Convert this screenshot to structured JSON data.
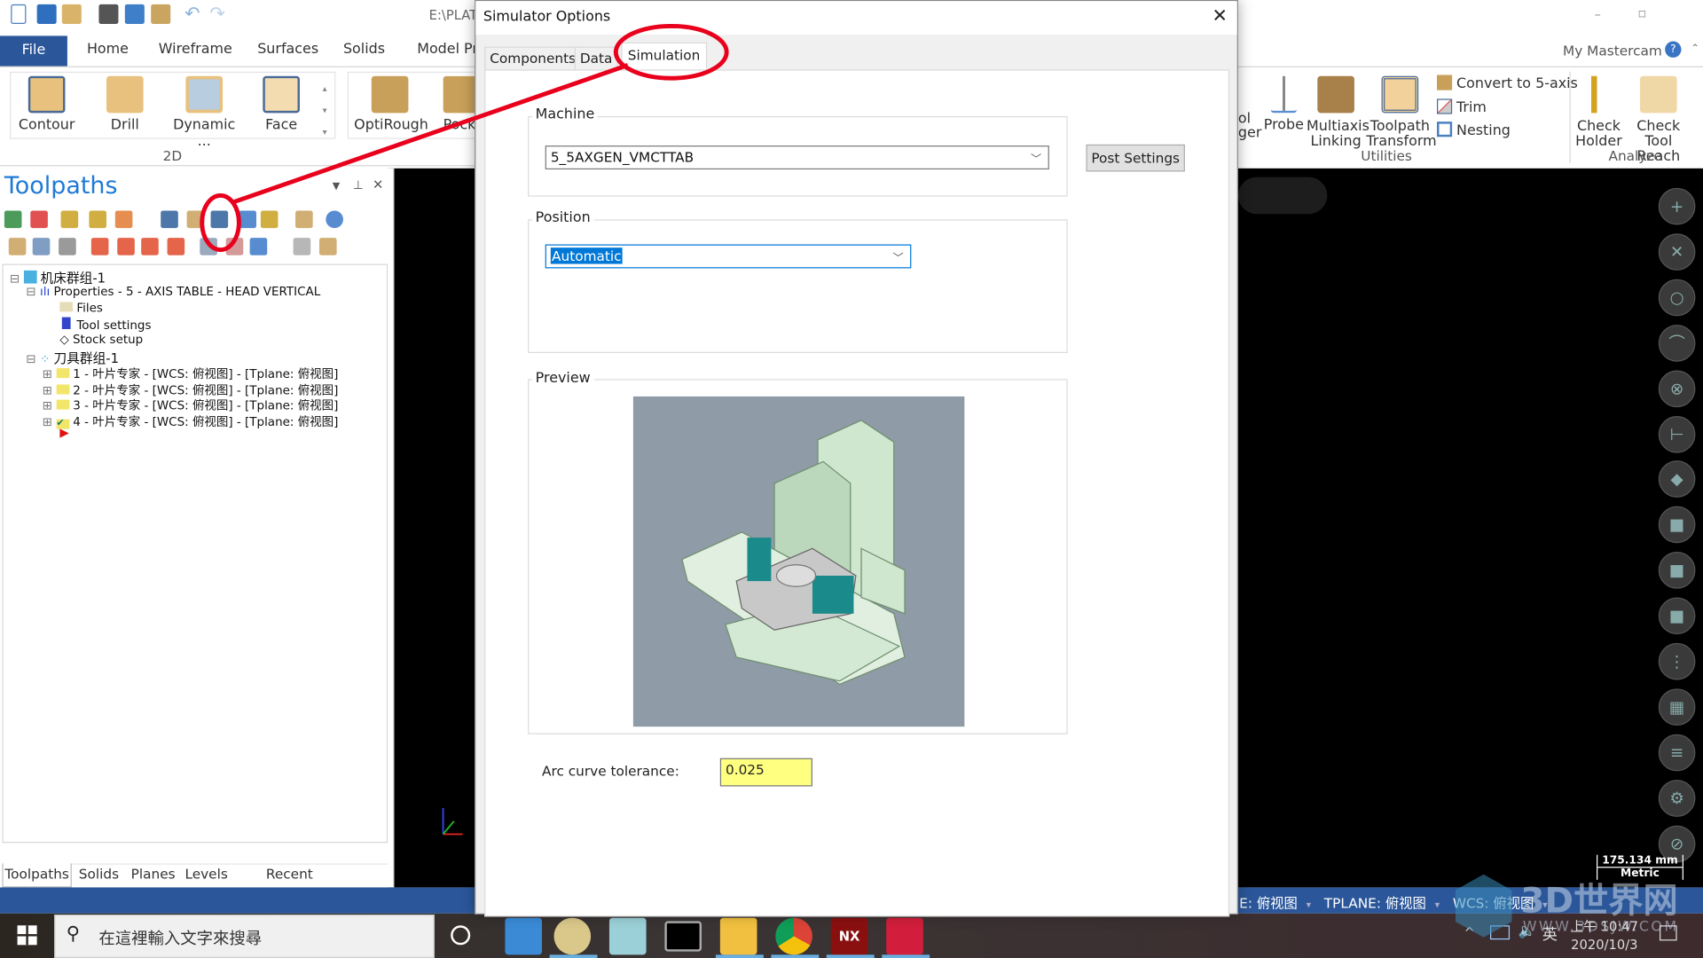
{
  "app": {
    "title_fragment": "E:\\PLAT",
    "my_mastercam": "My Mastercam"
  },
  "ribbon": {
    "tabs": [
      "File",
      "Home",
      "Wireframe",
      "Surfaces",
      "Solids",
      "Model Pr"
    ],
    "left_buttons": [
      "Contour",
      "Drill",
      "Dynamic ...",
      "Face",
      "OptiRough",
      "Pock"
    ],
    "left_group": "2D",
    "right_partial": [
      "ol",
      "ger"
    ],
    "probe": "Probe",
    "multiaxis": [
      "Multiaxis",
      "Linking"
    ],
    "transform": [
      "Toolpath",
      "Transform"
    ],
    "small": [
      "Convert to 5-axis",
      "Trim",
      "Nesting"
    ],
    "utilities_group": "Utilities",
    "check_holder": [
      "Check",
      "Holder"
    ],
    "check_reach": [
      "Check",
      "Tool Reach"
    ],
    "analyze_group": "Analyze"
  },
  "toolpaths": {
    "title": "Toolpaths",
    "tree": {
      "machine_group": "机床群组-1",
      "properties": "Properties - 5 - AXIS TABLE - HEAD VERTICAL",
      "files": "Files",
      "tool_settings": "Tool settings",
      "stock_setup": "Stock setup",
      "toolpath_group": "刀具群组-1",
      "ops": [
        "1 - 叶片专家 - [WCS: 俯视图] - [Tplane: 俯视图]",
        "2 - 叶片专家 - [WCS: 俯视图] - [Tplane: 俯视图]",
        "3 - 叶片专家 - [WCS: 俯视图] - [Tplane: 俯视图]",
        "4 - 叶片专家 - [WCS: 俯视图] - [Tplane: 俯视图]"
      ]
    },
    "bottom_tabs": [
      "Toolpaths",
      "Solids",
      "Planes",
      "Levels",
      "Recent Functions"
    ]
  },
  "dialog": {
    "title": "Simulator Options",
    "tabs": [
      "Components",
      "Data",
      "Simulation"
    ],
    "active_tab": "Simulation",
    "machine_label": "Machine",
    "machine_value": "5_5AXGEN_VMCTTAB",
    "post_settings": "Post Settings",
    "position_label": "Position",
    "position_value": "Automatic",
    "preview_label": "Preview",
    "arc_label": "Arc curve tolerance:",
    "arc_value": "0.025"
  },
  "status": {
    "items": [
      "E: 俯视图",
      "TPLANE: 俯视图",
      "WCS: 俯视图"
    ]
  },
  "scale": {
    "value": "175.134 mm",
    "unit": "Metric"
  },
  "taskbar": {
    "search_placeholder": "在這裡輸入文字來搜尋",
    "time": "上午 10:47",
    "date": "2020/10/3",
    "ime": "英"
  },
  "watermark": {
    "text": "3D世界网",
    "url_text": "WWW.3DSJW.COM"
  },
  "colors": {
    "accent": "#2b579a",
    "annotation": "#e8001c",
    "toolpaths_title": "#1e7ad6",
    "input_highlight": "#ffff80"
  }
}
